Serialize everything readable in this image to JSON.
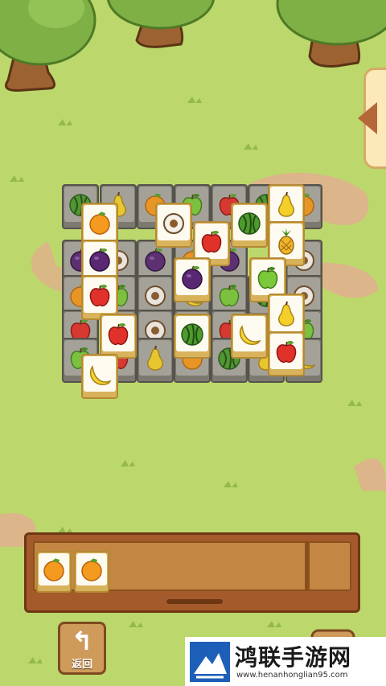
{
  "board": {
    "bottom_tiles": [
      "watermelon",
      "pear",
      "orange",
      "green-apple",
      "red-apple",
      "watermelon",
      "orange",
      "grape",
      "coconut",
      "grape",
      "orange",
      "grape",
      "coconut",
      "orange",
      "green-apple",
      "coconut",
      "banana",
      "green-apple",
      "watermelon",
      "coconut",
      "red-apple",
      "green-apple",
      "coconut",
      "pear",
      "red-apple",
      "green-apple",
      "green-apple",
      "red-apple",
      "pear",
      "orange",
      "watermelon",
      "pear",
      "banana"
    ],
    "top_tiles": [
      "orange",
      "coconut",
      "red-apple",
      "watermelon",
      "pear",
      "grape",
      "pineapple",
      "red-apple",
      "grape",
      "green-apple",
      "grape",
      "red-apple",
      "watermelon",
      "banana",
      "pear",
      "banana",
      "red-apple"
    ]
  },
  "tray": {
    "slots": [
      "orange",
      "orange"
    ]
  },
  "controls": {
    "back_label": "返回",
    "back_icon": "return-arrow-icon",
    "side_tab_icon": "triangle-left-icon"
  },
  "watermark": {
    "title": "鸿联手游网",
    "url": "www.henanhonglian95.com"
  }
}
